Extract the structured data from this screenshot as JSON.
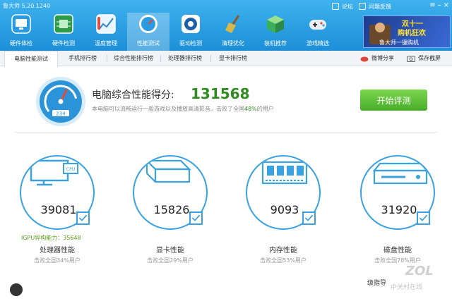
{
  "app": {
    "title": "鲁大师 5.20.1240"
  },
  "header": {
    "forum": "论坛",
    "feedback": "问题反馈"
  },
  "nav": [
    {
      "label": "硬件体检",
      "icon": "monitor-icon",
      "color": "#2a9be0"
    },
    {
      "label": "硬件检测",
      "icon": "circuit-board-icon",
      "color": "#2e9a4a"
    },
    {
      "label": "温度管理",
      "icon": "temperature-chart-icon",
      "color": "#2f86cf"
    },
    {
      "label": "性能测试",
      "icon": "speedometer-icon",
      "color": "#2a9be0"
    },
    {
      "label": "驱动检测",
      "icon": "gear-icon",
      "color": "#1d5fa8"
    },
    {
      "label": "清理优化",
      "icon": "broom-icon",
      "color": "#6b8e23"
    },
    {
      "label": "装机推荐",
      "icon": "box-icon",
      "color": "#3bb05c"
    },
    {
      "label": "游戏精选",
      "icon": "gamepad-icon",
      "color": "#e9eef5"
    }
  ],
  "nav_active_index": 3,
  "banner": {
    "line1": "双十一",
    "line2": "购机狂欢",
    "line3": "鲁大师一键购机"
  },
  "tabs": [
    "电脑性能测试",
    "手机排行榜",
    "综合性能排行榜",
    "处理器排行榜",
    "显卡排行榜"
  ],
  "share": {
    "weibo": "微博分享",
    "screenshot": "保存截屏"
  },
  "score": {
    "label": "电脑综合性能得分:",
    "value": "131568",
    "desc_prefix": "本电脑可以流畅运行一般游戏以及播放高清影音。击败了全国",
    "percent": "48%",
    "desc_suffix": "的用户",
    "gauge_number": "234"
  },
  "start_button": "开始评测",
  "cards": [
    {
      "value": "39081",
      "label": "处理器性能",
      "sub": "击败全国34%用户",
      "icon": "cpu-monitor-icon"
    },
    {
      "value": "15826",
      "label": "显卡性能",
      "sub": "击败全国29%用户",
      "icon": "graphics-card-icon"
    },
    {
      "value": "9093",
      "label": "内存性能",
      "sub": "击败全国53%用户",
      "icon": "memory-chip-icon"
    },
    {
      "value": "31920",
      "label": "磁盘性能",
      "sub": "击败全国78%用户",
      "icon": "hard-disk-icon"
    }
  ],
  "igpu": "IGPU异构能力：35648",
  "upgrade": "级指导",
  "watermark": {
    "brand": "ZOL",
    "sub": "中关村在线"
  },
  "colors": {
    "accent": "#3aa2e0",
    "score_green": "#2e8b1e",
    "button_green": "#48ad2a",
    "header": "#1c8fd8"
  }
}
